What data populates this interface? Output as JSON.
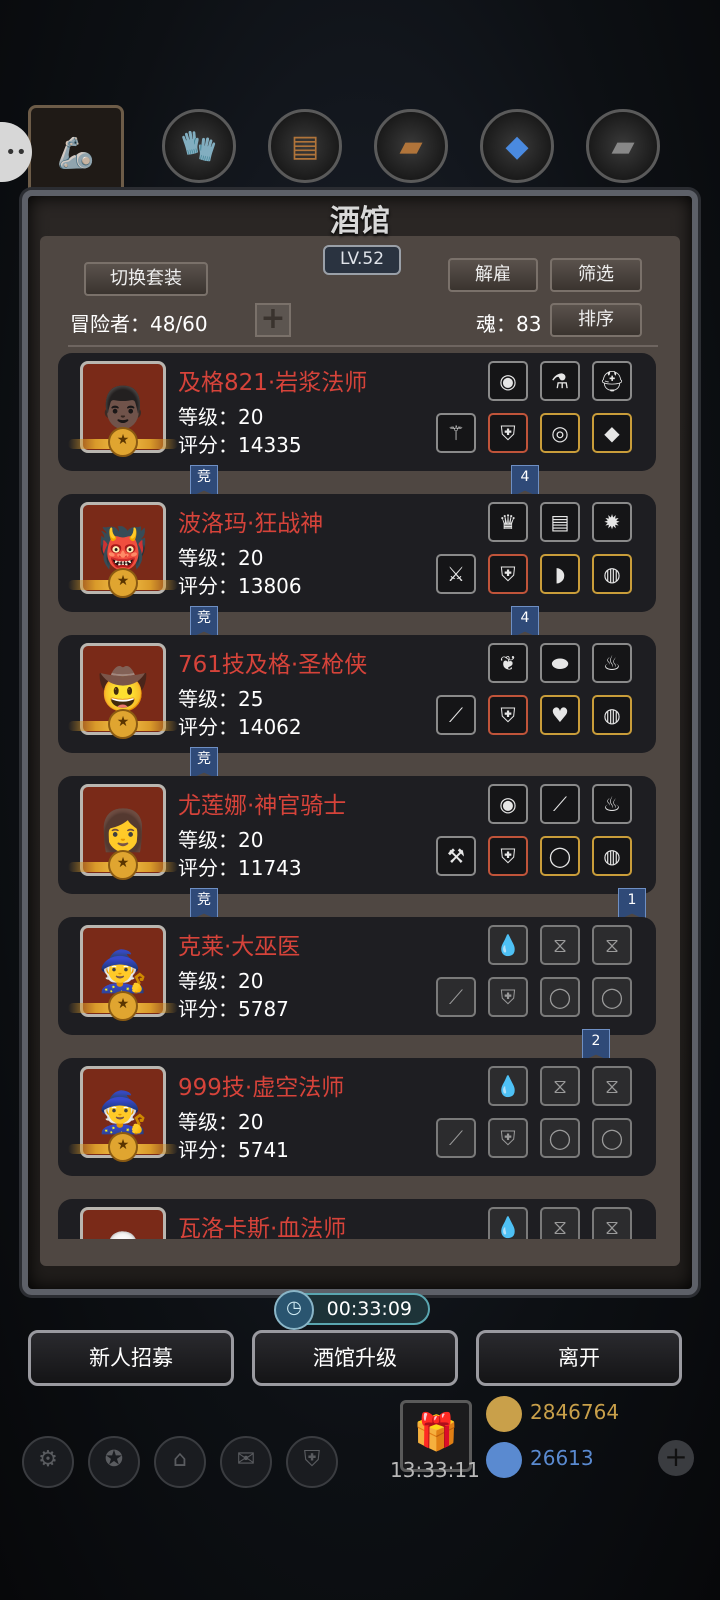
{
  "top_tabs": [
    {
      "icon": "arm-icon"
    },
    {
      "icon": "leather-gloves-icon"
    },
    {
      "icon": "wood-plank-icon"
    },
    {
      "icon": "iron-ingot-icon"
    },
    {
      "icon": "crystal-icon"
    },
    {
      "icon": "steel-bars-icon"
    }
  ],
  "header": {
    "title": "酒馆",
    "level": "LV.52",
    "switch_set": "切换套装",
    "dismiss": "解雇",
    "filter": "筛选",
    "sort": "排序",
    "adventurers_label": "冒险者：48/60",
    "souls_label": "魂：83",
    "add_symbol": "+"
  },
  "heroes": [
    {
      "name": "及格821·岩浆法师",
      "level": "等级：20",
      "score": "评分：14335",
      "left_tag": "竞",
      "right_tag": "4",
      "top_slots": [
        "blue-orb-icon",
        "red-potion-icon",
        "green-helmet-icon"
      ],
      "bottom_slots": [
        "staff-icon",
        "green-armor-icon",
        "purple-eye-icon",
        "red-gem-icon"
      ]
    },
    {
      "name": "波洛玛·狂战神",
      "level": "等级：20",
      "score": "评分：13806",
      "left_tag": "竞",
      "right_tag": "4",
      "top_slots": [
        "gold-helmet-icon",
        "book-icon",
        "fire-emblem-icon"
      ],
      "bottom_slots": [
        "purple-axe-icon",
        "knight-armor-icon",
        "bow-shield-icon",
        "ruby-ring-icon"
      ]
    },
    {
      "name": "761技及格·圣枪侠",
      "level": "等级：25",
      "score": "评分：14062",
      "left_tag": "竞",
      "right_tag": "",
      "top_slots": [
        "green-feather-icon",
        "cyan-stone-icon",
        "lantern-icon"
      ],
      "bottom_slots": [
        "rifle-icon",
        "silver-armor-icon",
        "heart-pendant-icon",
        "fire-ring-icon"
      ]
    },
    {
      "name": "尤莲娜·神官骑士",
      "level": "等级：20",
      "score": "评分：11743",
      "left_tag": "竞",
      "right_tag": "1",
      "top_slots": [
        "blue-orb-icon",
        "dark-bow-icon",
        "lantern-icon"
      ],
      "bottom_slots": [
        "mace-icon",
        "robe-icon",
        "gold-bracelet-icon",
        "gold-ring-icon"
      ]
    },
    {
      "name": "克莱·大巫医",
      "level": "等级：20",
      "score": "评分：5787",
      "left_tag": "",
      "right_tag": "2",
      "top_slots": [
        "empty-drop-icon",
        "empty-hourglass-icon",
        "empty-hourglass-icon"
      ],
      "bottom_slots": [
        "empty-staff-icon",
        "empty-armor-icon",
        "empty-ring-icon",
        "empty-ring-icon"
      ]
    },
    {
      "name": "999技·虚空法师",
      "level": "等级：20",
      "score": "评分：5741",
      "left_tag": "",
      "right_tag": "",
      "top_slots": [
        "empty-drop-icon",
        "empty-hourglass-icon",
        "empty-hourglass-icon"
      ],
      "bottom_slots": [
        "empty-staff-icon",
        "empty-armor-icon",
        "empty-ring-icon",
        "empty-ring-icon"
      ]
    },
    {
      "name": "瓦洛卡斯·血法师",
      "level": "",
      "score": "",
      "left_tag": "",
      "right_tag": "",
      "top_slots": [
        "empty-drop-icon",
        "empty-hourglass-icon",
        "empty-hourglass-icon"
      ],
      "bottom_slots": []
    }
  ],
  "timer": "00:33:09",
  "buttons": {
    "recruit": "新人招募",
    "upgrade": "酒馆升级",
    "leave": "离开"
  },
  "bottom_bar": {
    "clock": "13:33:11",
    "gold": "2846764",
    "gems": "26613",
    "colors": {
      "gold": "#c9a04a",
      "gems": "#5a8ad0"
    }
  },
  "colors": {
    "hero_name": "#d6433a",
    "tag_blue": "#2f4a78"
  }
}
